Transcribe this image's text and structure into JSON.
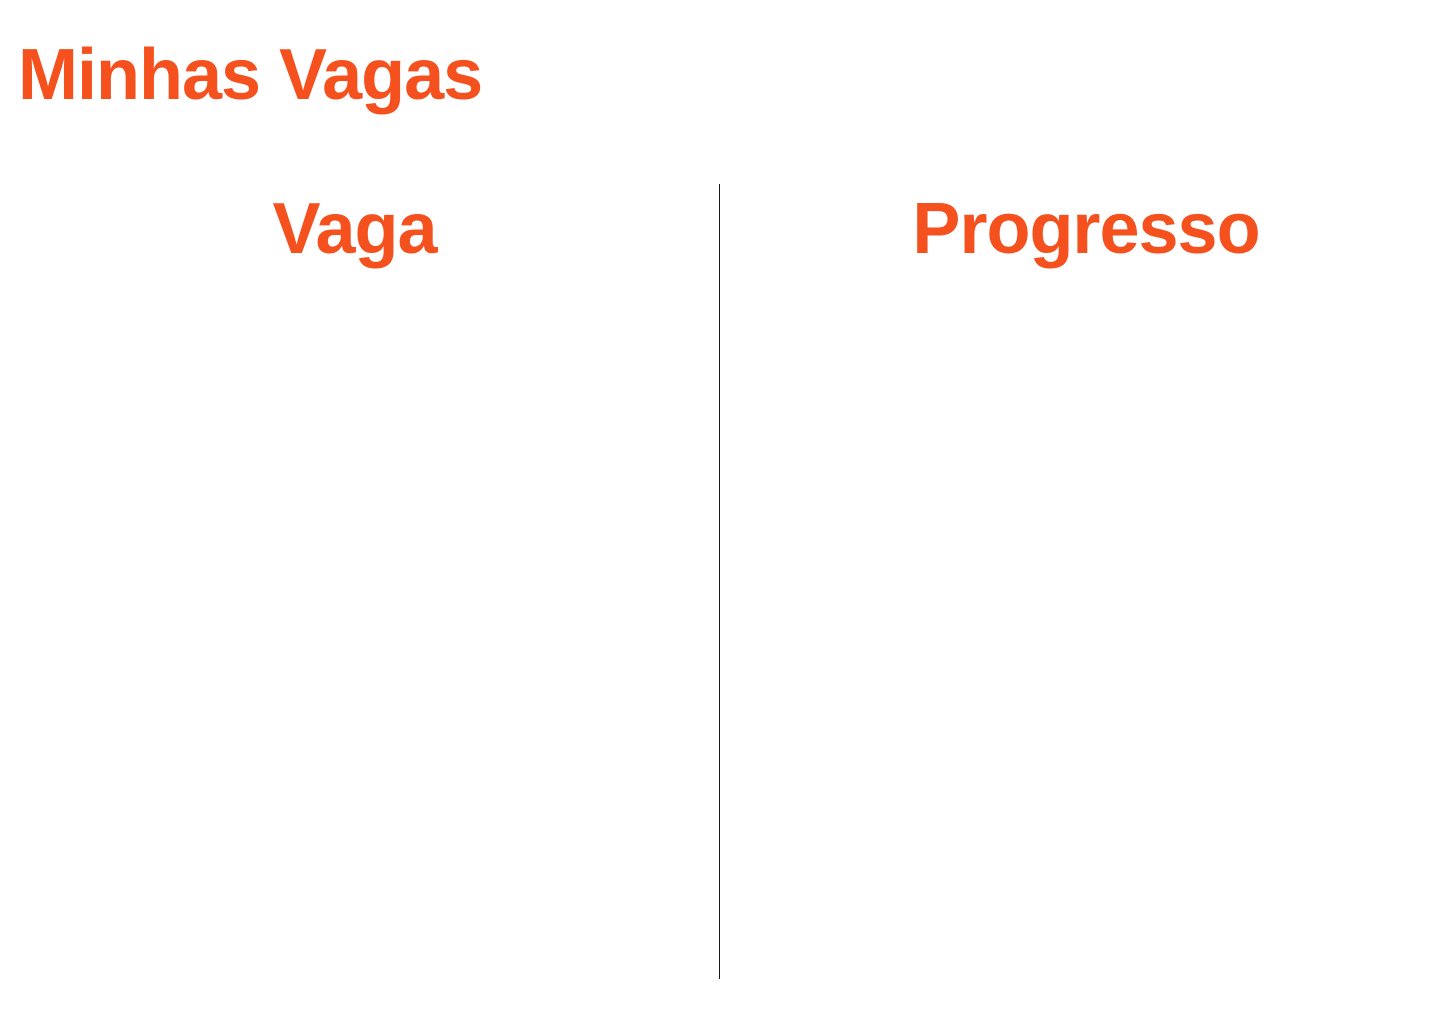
{
  "page": {
    "title": "Minhas Vagas"
  },
  "table": {
    "columns": [
      {
        "label": "Vaga"
      },
      {
        "label": "Progresso"
      }
    ],
    "rows": []
  },
  "colors": {
    "accent": "#f4511e",
    "divider": "#1a1a1a",
    "background": "#ffffff"
  }
}
